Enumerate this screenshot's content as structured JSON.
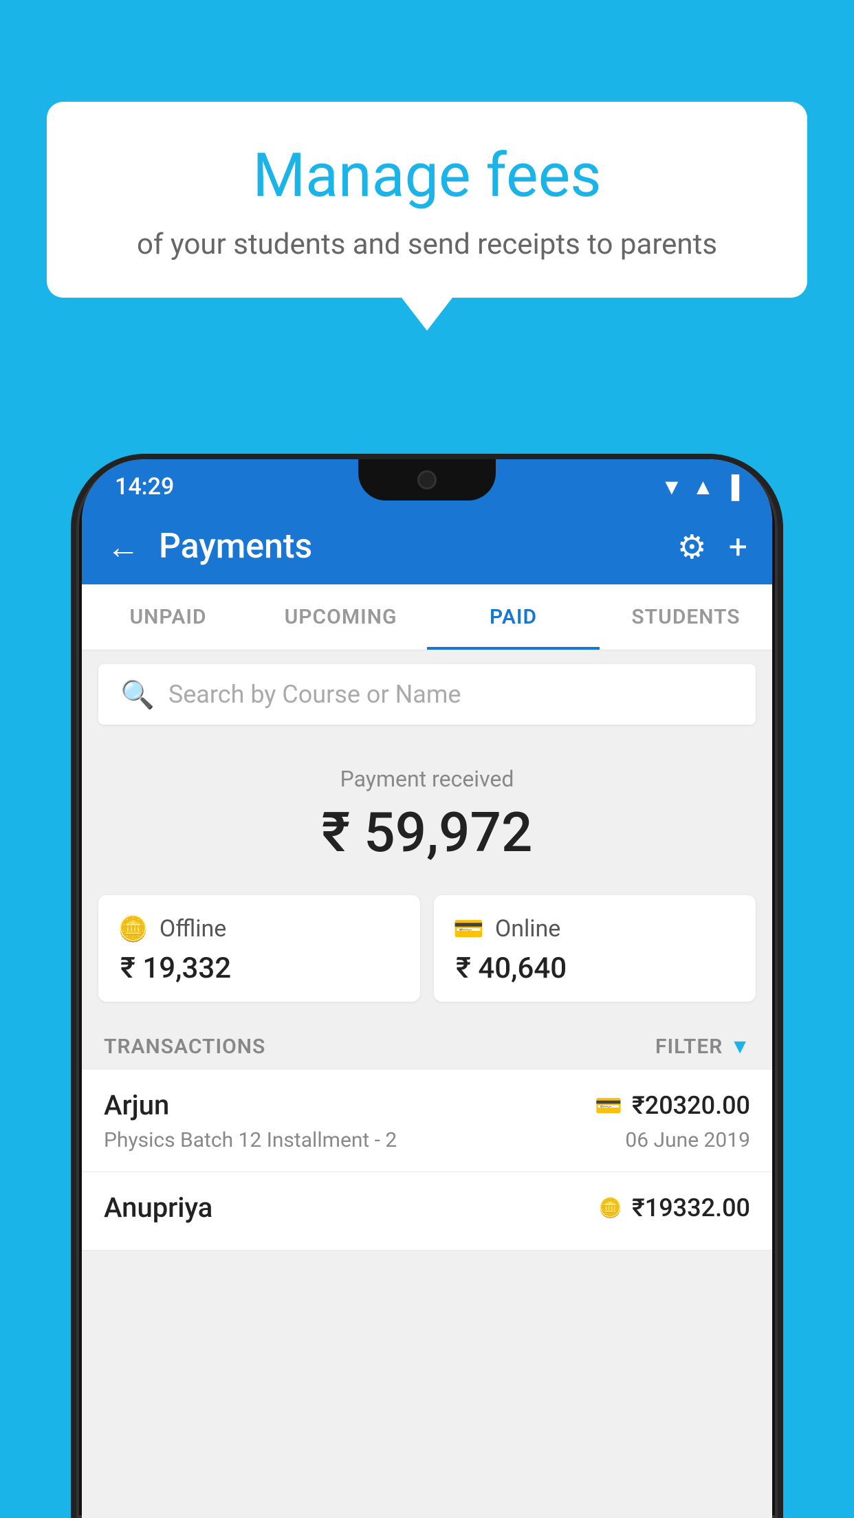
{
  "page": {
    "background_color": "#1ab4e8"
  },
  "bubble": {
    "title": "Manage fees",
    "subtitle": "of your students and send receipts to parents"
  },
  "status_bar": {
    "time": "14:29",
    "wifi": "▼",
    "signal": "▲",
    "battery": "▐"
  },
  "app_bar": {
    "title": "Payments",
    "back_label": "←",
    "gear_label": "⚙",
    "plus_label": "+"
  },
  "tabs": [
    {
      "label": "UNPAID",
      "active": false
    },
    {
      "label": "UPCOMING",
      "active": false
    },
    {
      "label": "PAID",
      "active": true
    },
    {
      "label": "STUDENTS",
      "active": false
    }
  ],
  "search": {
    "placeholder": "Search by Course or Name"
  },
  "payment_received": {
    "label": "Payment received",
    "amount": "₹ 59,972"
  },
  "payment_cards": [
    {
      "icon": "💳",
      "label": "Offline",
      "amount": "₹ 19,332"
    },
    {
      "icon": "🏧",
      "label": "Online",
      "amount": "₹ 40,640"
    }
  ],
  "transactions_header": {
    "label": "TRANSACTIONS",
    "filter_label": "FILTER",
    "filter_icon": "▼"
  },
  "transactions": [
    {
      "name": "Arjun",
      "amount": "₹20320.00",
      "course": "Physics Batch 12 Installment - 2",
      "date": "06 June 2019",
      "payment_type": "card"
    },
    {
      "name": "Anupriya",
      "amount": "₹19332.00",
      "course": "",
      "date": "",
      "payment_type": "rupee"
    }
  ]
}
